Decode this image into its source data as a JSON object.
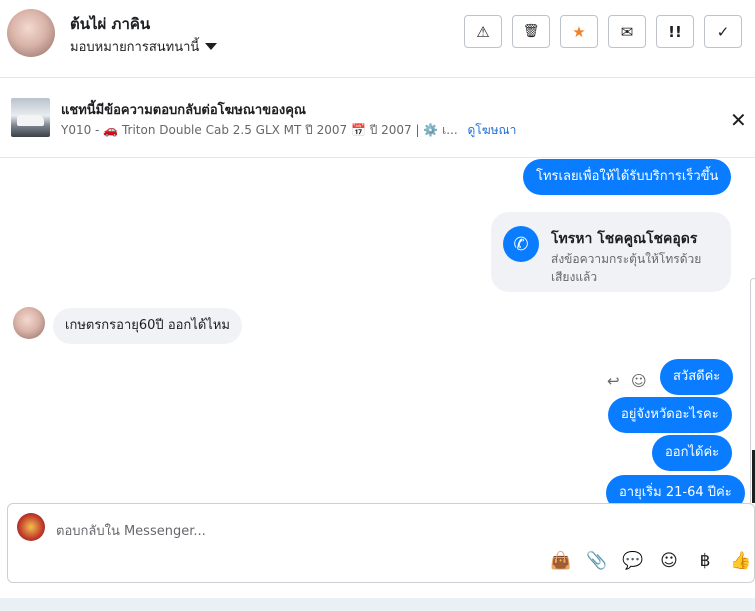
{
  "header": {
    "name": "ต้นไผ่ ภาคิน",
    "assign_label": "มอบหมายการสนทนานี้",
    "tools": [
      {
        "name": "report-icon",
        "glyph": "⚠"
      },
      {
        "name": "trash-icon",
        "glyph": "🗑"
      },
      {
        "name": "star-icon",
        "glyph": "★",
        "color": "#f0822d"
      },
      {
        "name": "mark-unread-icon",
        "glyph": "✉"
      },
      {
        "name": "priority-icon",
        "glyph": "!!"
      },
      {
        "name": "done-icon",
        "glyph": "✓"
      }
    ]
  },
  "banner": {
    "title": "แชทนี้มีข้อความตอบกลับต่อโฆษณาของคุณ",
    "subtitle": "Y010 - 🚗 Triton Double Cab 2.5 GLX MT ปี 2007 📅 ปี 2007 | ⚙️ เ...",
    "link": "ดูโฆษณา",
    "close": "✕"
  },
  "messages": {
    "out_top": "โทรเลยเพื่อให้ได้รับบริการเร็วขึ้น",
    "call_title": "โทรหา โชคคูณโชคอุดร",
    "call_sub": "ส่งข้อความกระตุ้นให้โทรด้วยเสียงแล้ว",
    "call_icon": "✆",
    "incoming": "เกษตรกรอายุ60ปี ออกได้ไหม",
    "reply_icon": "↩",
    "emoji_icon": "☺",
    "out_1": "สวัสดีค่ะ",
    "out_2": "อยู่จังหวัดอะไรคะ",
    "out_3": "ออกได้ค่ะ",
    "out_4": "อายุเริ่ม 21-64 ปีค่ะ"
  },
  "composer": {
    "placeholder": "ตอบกลับใน Messenger...",
    "tools": [
      {
        "name": "shopping-bag-icon",
        "glyph": "👜"
      },
      {
        "name": "attachment-icon",
        "glyph": "📎"
      },
      {
        "name": "saved-reply-icon",
        "glyph": "💬"
      },
      {
        "name": "emoji-icon",
        "glyph": "☺"
      },
      {
        "name": "baht-icon",
        "glyph": "฿"
      },
      {
        "name": "like-icon",
        "glyph": "👍"
      }
    ]
  },
  "colors": {
    "accent": "#0a7cff",
    "star": "#f0822d",
    "link": "#216fdb"
  }
}
